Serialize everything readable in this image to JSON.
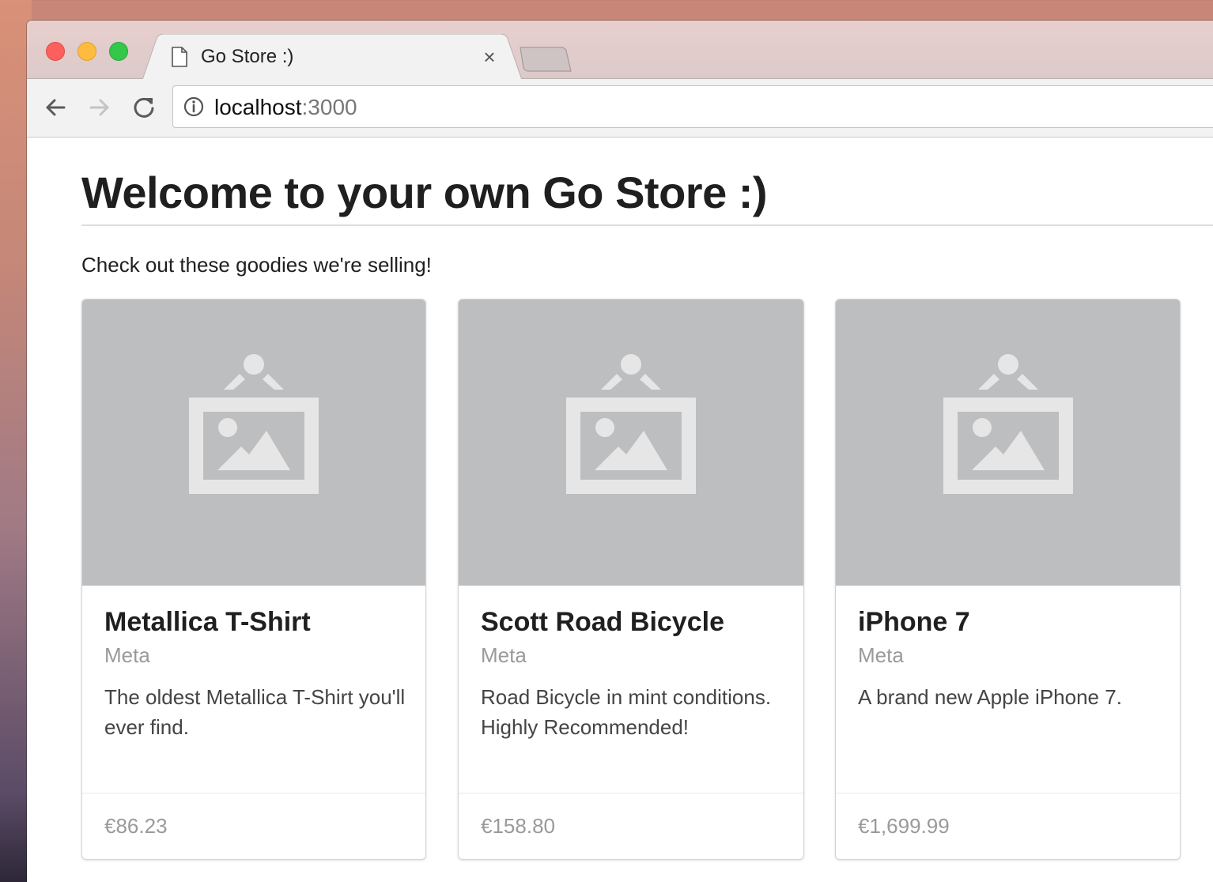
{
  "browser": {
    "tab_title": "Go Store :)",
    "close_glyph": "×",
    "url_host": "localhost",
    "url_port": ":3000",
    "icons": {
      "tab_icon": "document-icon",
      "back": "back-arrow-icon",
      "forward": "forward-arrow-icon",
      "reload": "reload-icon",
      "info": "info-icon"
    },
    "colors": {
      "close": "#fc605c",
      "minimize": "#fdbc40",
      "zoom": "#34c84a"
    }
  },
  "page": {
    "title": "Welcome to your own Go Store :)",
    "subtitle": "Check out these goodies we're selling!"
  },
  "products": [
    {
      "name": "Metallica T-Shirt",
      "meta": "Meta",
      "description": "The oldest Metallica T-Shirt you'll ever find.",
      "price": "€86.23"
    },
    {
      "name": "Scott Road Bicycle",
      "meta": "Meta",
      "description": "Road Bicycle in mint conditions. Highly Recommended!",
      "price": "€158.80"
    },
    {
      "name": "iPhone 7",
      "meta": "Meta",
      "description": "A brand new Apple iPhone 7.",
      "price": "€1,699.99"
    }
  ]
}
